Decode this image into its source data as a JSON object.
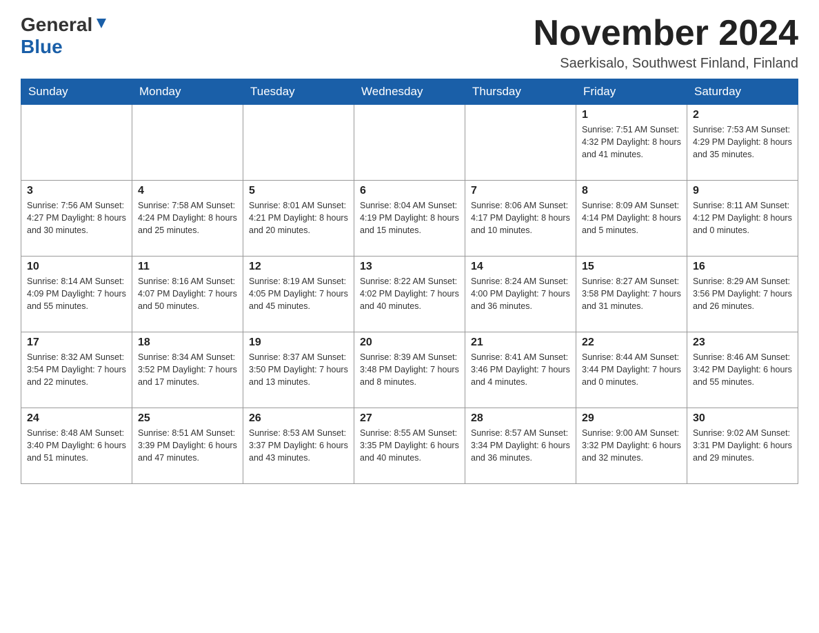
{
  "header": {
    "logo_general": "General",
    "logo_blue": "Blue",
    "month_title": "November 2024",
    "location": "Saerkisalo, Southwest Finland, Finland"
  },
  "weekdays": [
    "Sunday",
    "Monday",
    "Tuesday",
    "Wednesday",
    "Thursday",
    "Friday",
    "Saturday"
  ],
  "weeks": [
    [
      {
        "day": "",
        "info": ""
      },
      {
        "day": "",
        "info": ""
      },
      {
        "day": "",
        "info": ""
      },
      {
        "day": "",
        "info": ""
      },
      {
        "day": "",
        "info": ""
      },
      {
        "day": "1",
        "info": "Sunrise: 7:51 AM\nSunset: 4:32 PM\nDaylight: 8 hours\nand 41 minutes."
      },
      {
        "day": "2",
        "info": "Sunrise: 7:53 AM\nSunset: 4:29 PM\nDaylight: 8 hours\nand 35 minutes."
      }
    ],
    [
      {
        "day": "3",
        "info": "Sunrise: 7:56 AM\nSunset: 4:27 PM\nDaylight: 8 hours\nand 30 minutes."
      },
      {
        "day": "4",
        "info": "Sunrise: 7:58 AM\nSunset: 4:24 PM\nDaylight: 8 hours\nand 25 minutes."
      },
      {
        "day": "5",
        "info": "Sunrise: 8:01 AM\nSunset: 4:21 PM\nDaylight: 8 hours\nand 20 minutes."
      },
      {
        "day": "6",
        "info": "Sunrise: 8:04 AM\nSunset: 4:19 PM\nDaylight: 8 hours\nand 15 minutes."
      },
      {
        "day": "7",
        "info": "Sunrise: 8:06 AM\nSunset: 4:17 PM\nDaylight: 8 hours\nand 10 minutes."
      },
      {
        "day": "8",
        "info": "Sunrise: 8:09 AM\nSunset: 4:14 PM\nDaylight: 8 hours\nand 5 minutes."
      },
      {
        "day": "9",
        "info": "Sunrise: 8:11 AM\nSunset: 4:12 PM\nDaylight: 8 hours\nand 0 minutes."
      }
    ],
    [
      {
        "day": "10",
        "info": "Sunrise: 8:14 AM\nSunset: 4:09 PM\nDaylight: 7 hours\nand 55 minutes."
      },
      {
        "day": "11",
        "info": "Sunrise: 8:16 AM\nSunset: 4:07 PM\nDaylight: 7 hours\nand 50 minutes."
      },
      {
        "day": "12",
        "info": "Sunrise: 8:19 AM\nSunset: 4:05 PM\nDaylight: 7 hours\nand 45 minutes."
      },
      {
        "day": "13",
        "info": "Sunrise: 8:22 AM\nSunset: 4:02 PM\nDaylight: 7 hours\nand 40 minutes."
      },
      {
        "day": "14",
        "info": "Sunrise: 8:24 AM\nSunset: 4:00 PM\nDaylight: 7 hours\nand 36 minutes."
      },
      {
        "day": "15",
        "info": "Sunrise: 8:27 AM\nSunset: 3:58 PM\nDaylight: 7 hours\nand 31 minutes."
      },
      {
        "day": "16",
        "info": "Sunrise: 8:29 AM\nSunset: 3:56 PM\nDaylight: 7 hours\nand 26 minutes."
      }
    ],
    [
      {
        "day": "17",
        "info": "Sunrise: 8:32 AM\nSunset: 3:54 PM\nDaylight: 7 hours\nand 22 minutes."
      },
      {
        "day": "18",
        "info": "Sunrise: 8:34 AM\nSunset: 3:52 PM\nDaylight: 7 hours\nand 17 minutes."
      },
      {
        "day": "19",
        "info": "Sunrise: 8:37 AM\nSunset: 3:50 PM\nDaylight: 7 hours\nand 13 minutes."
      },
      {
        "day": "20",
        "info": "Sunrise: 8:39 AM\nSunset: 3:48 PM\nDaylight: 7 hours\nand 8 minutes."
      },
      {
        "day": "21",
        "info": "Sunrise: 8:41 AM\nSunset: 3:46 PM\nDaylight: 7 hours\nand 4 minutes."
      },
      {
        "day": "22",
        "info": "Sunrise: 8:44 AM\nSunset: 3:44 PM\nDaylight: 7 hours\nand 0 minutes."
      },
      {
        "day": "23",
        "info": "Sunrise: 8:46 AM\nSunset: 3:42 PM\nDaylight: 6 hours\nand 55 minutes."
      }
    ],
    [
      {
        "day": "24",
        "info": "Sunrise: 8:48 AM\nSunset: 3:40 PM\nDaylight: 6 hours\nand 51 minutes."
      },
      {
        "day": "25",
        "info": "Sunrise: 8:51 AM\nSunset: 3:39 PM\nDaylight: 6 hours\nand 47 minutes."
      },
      {
        "day": "26",
        "info": "Sunrise: 8:53 AM\nSunset: 3:37 PM\nDaylight: 6 hours\nand 43 minutes."
      },
      {
        "day": "27",
        "info": "Sunrise: 8:55 AM\nSunset: 3:35 PM\nDaylight: 6 hours\nand 40 minutes."
      },
      {
        "day": "28",
        "info": "Sunrise: 8:57 AM\nSunset: 3:34 PM\nDaylight: 6 hours\nand 36 minutes."
      },
      {
        "day": "29",
        "info": "Sunrise: 9:00 AM\nSunset: 3:32 PM\nDaylight: 6 hours\nand 32 minutes."
      },
      {
        "day": "30",
        "info": "Sunrise: 9:02 AM\nSunset: 3:31 PM\nDaylight: 6 hours\nand 29 minutes."
      }
    ]
  ]
}
